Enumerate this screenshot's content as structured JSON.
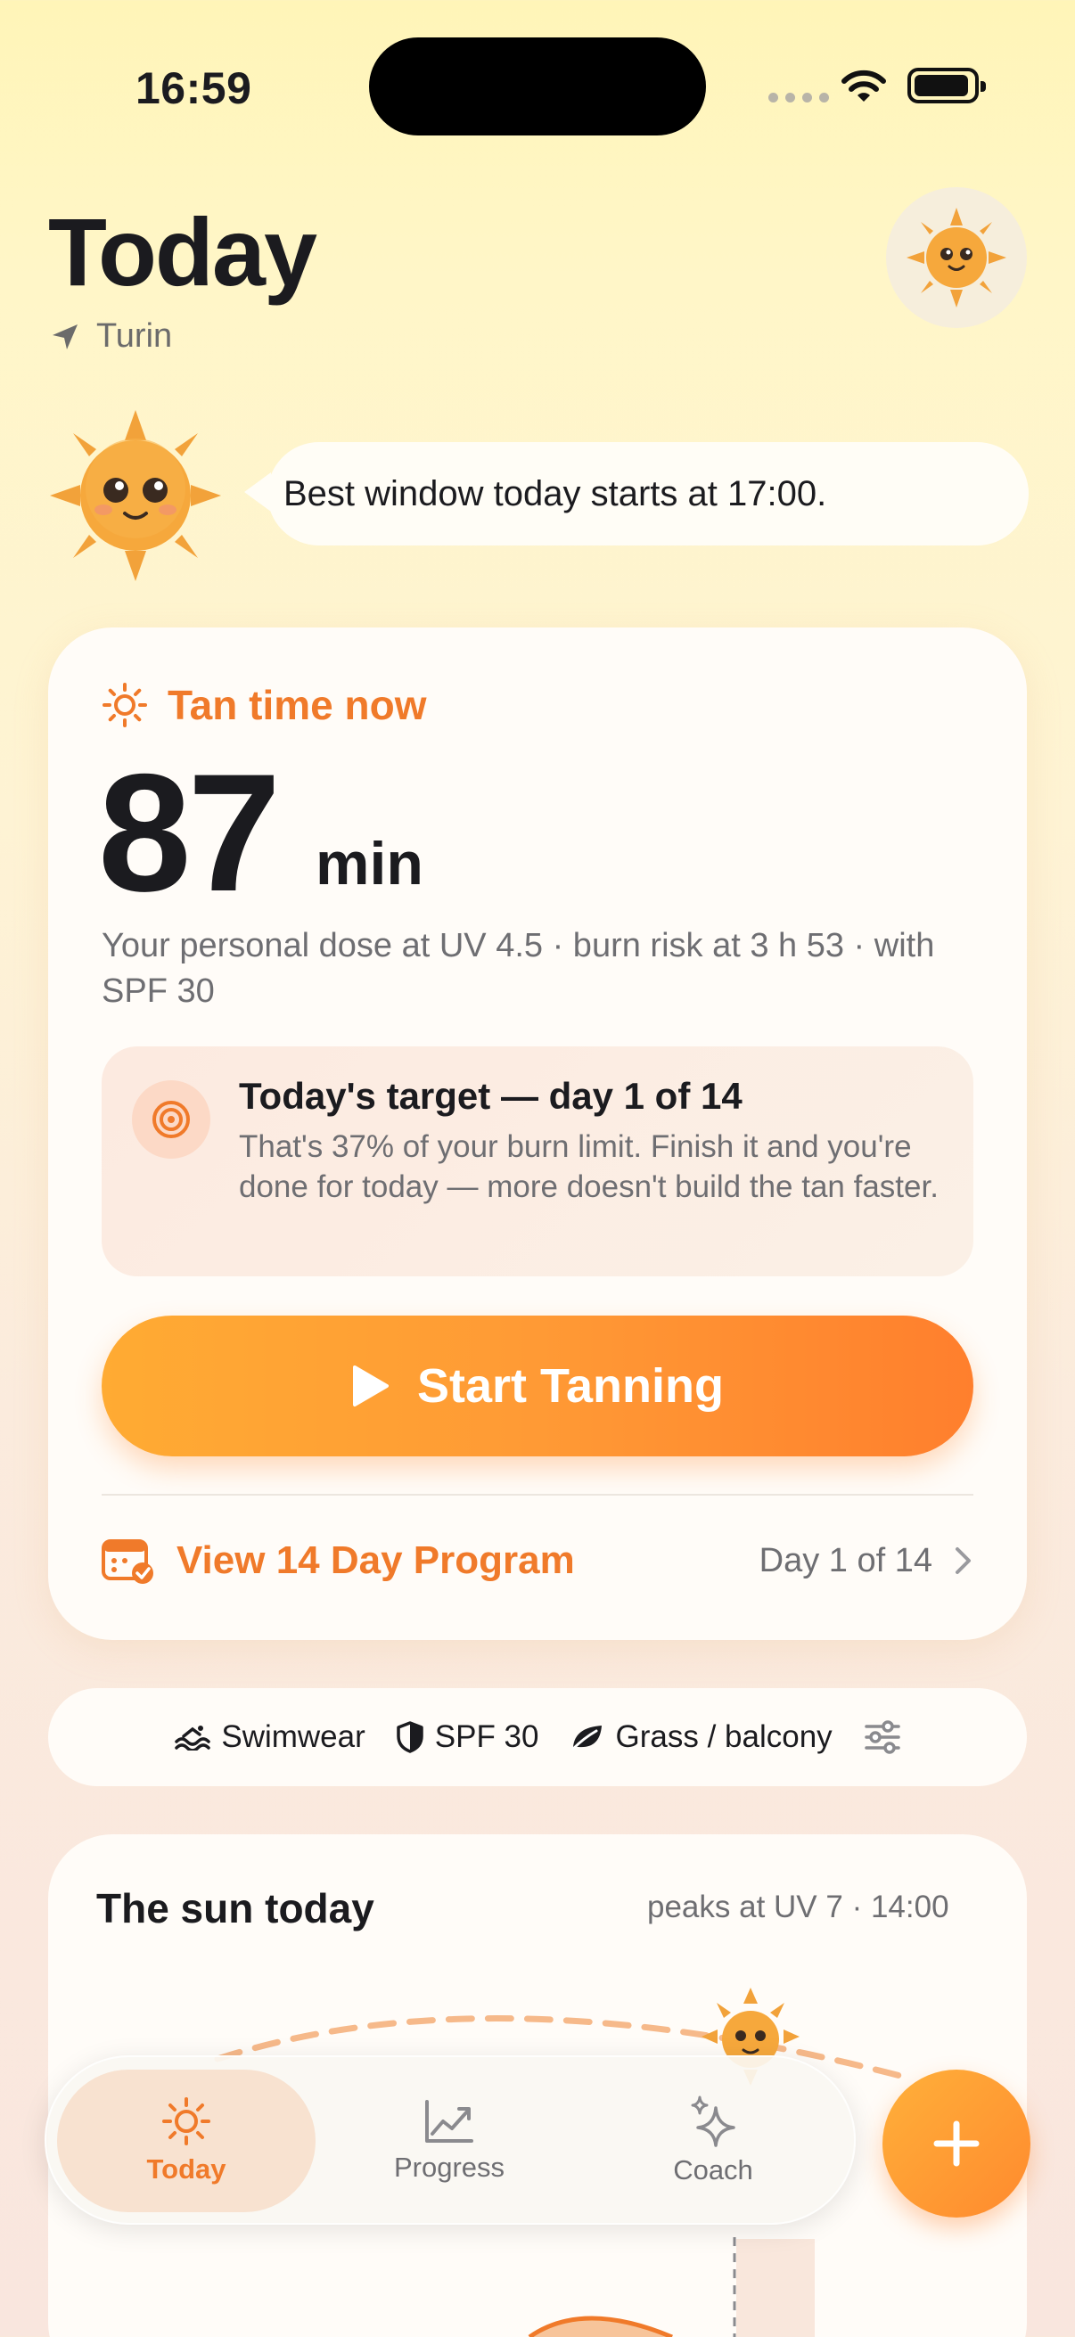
{
  "status_bar": {
    "time": "16:59"
  },
  "header": {
    "title": "Today",
    "location": "Turin"
  },
  "mascot_bubble": {
    "text": "Best window today starts at 17:00."
  },
  "tan_card": {
    "label": "Tan time now",
    "value": "87",
    "unit": "min",
    "description": "Your personal dose at UV 4.5 · burn risk at 3 h 53 · with SPF 30",
    "target": {
      "title": "Today's target — day 1 of 14",
      "description": "That's 37% of your burn limit. Finish it and you're done for today — more doesn't build the tan faster."
    },
    "start_button": "Start Tanning",
    "program_link": "View 14 Day Program",
    "program_day": "Day 1 of 14"
  },
  "preferences": {
    "clothing": "Swimwear",
    "spf": "SPF 30",
    "surface": "Grass / balcony"
  },
  "sun_card": {
    "title": "The sun today",
    "peak": "peaks at UV 7 · 14:00"
  },
  "tabs": [
    {
      "label": "Today",
      "icon": "sun-icon",
      "active": true
    },
    {
      "label": "Progress",
      "icon": "chart-icon",
      "active": false
    },
    {
      "label": "Coach",
      "icon": "sparkle-icon",
      "active": false
    }
  ],
  "colors": {
    "accent": "#F07A2A",
    "button_start": "#FFAB33",
    "button_end": "#FF7F2D"
  }
}
